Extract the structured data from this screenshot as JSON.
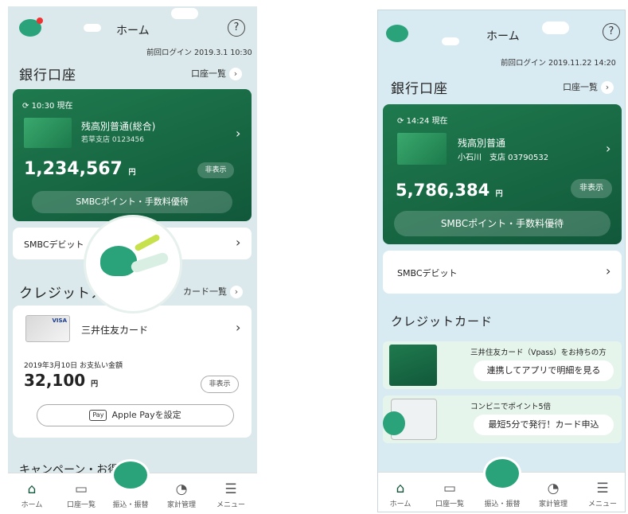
{
  "left": {
    "header": {
      "title": "ホーム",
      "help": "?",
      "last_login": "前回ログイン 2019.3.1 10:30"
    },
    "bank": {
      "section_title": "銀行口座",
      "list_link": "口座一覧",
      "time": "10:30 現在",
      "account_name": "残高別普通(総合)",
      "branch": "若草支店 0123456",
      "balance": "1,234,567",
      "yen": "円",
      "hide_label": "非表示",
      "points_label": "SMBCポイント・手数料優待"
    },
    "debit": {
      "label": "SMBCデビット"
    },
    "credit": {
      "section_title": "クレジットカード",
      "list_link": "カード一覧",
      "card_name": "三井住友カード",
      "card_brand": "VISA",
      "pay_date": "2019年3月10日 お支払い金額",
      "amount": "32,100",
      "yen": "円",
      "hide_label": "非表示",
      "apple_pay_badge": "Pay",
      "apple_pay_label": "Apple Payを設定"
    },
    "campaign": {
      "label": "キャンペーン・お得情報"
    },
    "nav": [
      {
        "label": "ホーム",
        "icon": "home-icon"
      },
      {
        "label": "口座一覧",
        "icon": "card-icon"
      },
      {
        "label": "振込・振替",
        "icon": "mascot-icon"
      },
      {
        "label": "家計管理",
        "icon": "chart-icon"
      },
      {
        "label": "メニュー",
        "icon": "menu-icon"
      }
    ]
  },
  "right": {
    "header": {
      "title": "ホーム",
      "help": "?",
      "last_login": "前回ログイン 2019.11.22 14:20"
    },
    "bank": {
      "section_title": "銀行口座",
      "list_link": "口座一覧",
      "time": "14:24 現在",
      "account_name": "残高別普通",
      "branch": "小石川　支店 03790532",
      "balance": "5,786,384",
      "yen": "円",
      "hide_label": "非表示",
      "points_label": "SMBCポイント・手数料優待"
    },
    "debit": {
      "label": "SMBCデビット"
    },
    "credit": {
      "section_title": "クレジットカード",
      "promo1_text": "三井住友カード（Vpass）をお持ちの方",
      "promo1_button": "連携してアプリで明細を見る",
      "promo2_text": "コンビニでポイント5倍",
      "promo2_button": "最短5分で発行！カード申込"
    },
    "nav": [
      {
        "label": "ホーム",
        "icon": "home-icon"
      },
      {
        "label": "口座一覧",
        "icon": "card-icon"
      },
      {
        "label": "振込・振替",
        "icon": "mascot-icon"
      },
      {
        "label": "家計管理",
        "icon": "chart-icon"
      },
      {
        "label": "メニュー",
        "icon": "menu-icon"
      }
    ]
  },
  "colors": {
    "brand_green": "#1c7a4e",
    "mascot_green": "#2aa37a",
    "bg_left": "#dbe9ec",
    "bg_right": "#d8eaf2"
  }
}
